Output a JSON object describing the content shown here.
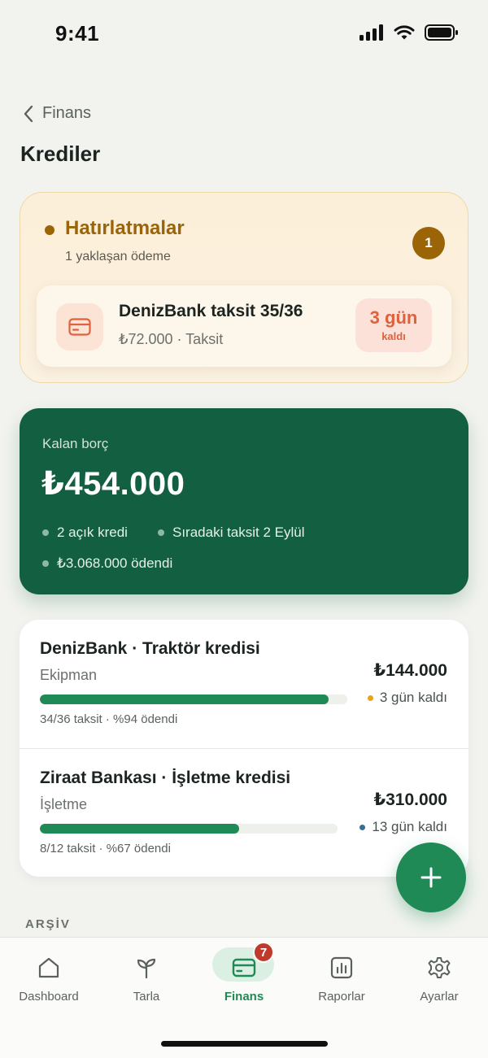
{
  "status_bar": {
    "time": "9:41"
  },
  "header": {
    "back_label": "Finans",
    "title": "Krediler"
  },
  "reminders": {
    "title": "Hatırlatmalar",
    "subtitle": "1 yaklaşan ödeme",
    "count": "1",
    "item": {
      "title": "DenizBank taksit 35/36",
      "meta": "₺72.000 · Taksit",
      "days": "3 gün",
      "days_suffix": "kaldı"
    }
  },
  "debt": {
    "label": "Kalan borç",
    "amount": "₺454.000",
    "open_credits": "2 açık kredi",
    "next_installment": "Sıradaki taksit 2 Eylül",
    "paid": "₺3.068.000 ödendi"
  },
  "credits": [
    {
      "title": "DenizBank · Traktör kredisi",
      "category": "Ekipman",
      "amount": "₺144.000",
      "due": "3 gün kaldı",
      "due_color": "#e9a21a",
      "progress_text": "34/36 taksit · %94 ödendi",
      "progress": 0.94
    },
    {
      "title": "Ziraat Bankası · İşletme kredisi",
      "category": "İşletme",
      "amount": "₺310.000",
      "due": "13 gün kaldı",
      "due_color": "#3b6d8c",
      "progress_text": "8/12 taksit · %67 ödendi",
      "progress": 0.67
    }
  ],
  "archive_label": "ARŞİV",
  "nav": {
    "items": [
      {
        "label": "Dashboard",
        "icon": "home-icon"
      },
      {
        "label": "Tarla",
        "icon": "sprout-icon"
      },
      {
        "label": "Finans",
        "icon": "card-icon",
        "badge": "7"
      },
      {
        "label": "Raporlar",
        "icon": "report-icon"
      },
      {
        "label": "Ayarlar",
        "icon": "gear-icon"
      }
    ],
    "active": "Finans"
  },
  "colors": {
    "primary": "#1f8a55",
    "dark_green": "#135f41",
    "amber": "#9a6407",
    "alert": "#e0623c"
  }
}
